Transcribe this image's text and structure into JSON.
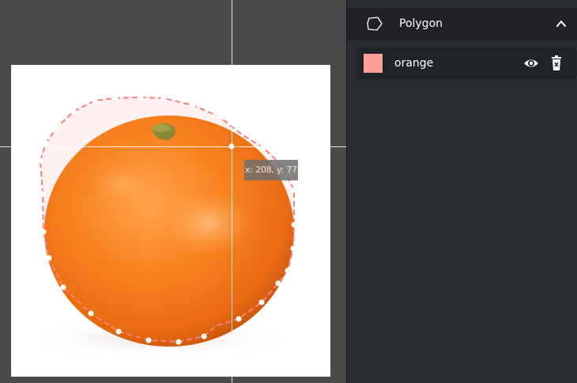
{
  "canvas": {
    "coord_readout": "x: 208, y: 77",
    "image_subject": "orange fruit photo",
    "polygon_color": "#ff7f7f"
  },
  "sidebar": {
    "panel": {
      "title": "Polygon",
      "icon": "polygon-icon",
      "toggle_icon": "chevron-up-icon",
      "accent_color": "#1e8ff0"
    },
    "labels": [
      {
        "name": "orange",
        "color": "#ff9f9a",
        "visibility_icon": "eye-icon",
        "delete_icon": "delete-icon"
      }
    ]
  }
}
